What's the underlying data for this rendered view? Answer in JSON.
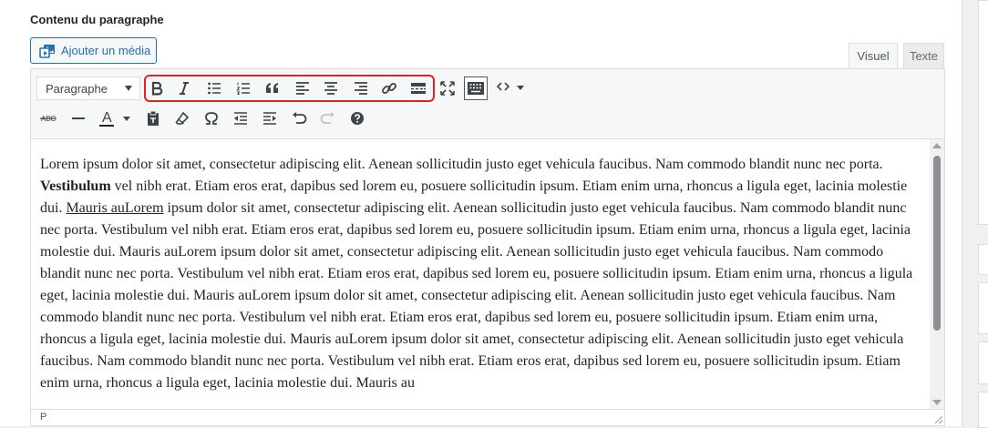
{
  "section": {
    "title": "Contenu du paragraphe"
  },
  "media_button": {
    "label": "Ajouter un média",
    "icon": "media-icon"
  },
  "tabs": [
    {
      "label": "Visuel",
      "active": true
    },
    {
      "label": "Texte",
      "active": false
    }
  ],
  "toolbar": {
    "format_select": {
      "value": "Paragraphe"
    },
    "row1_icons": [
      "bold-icon",
      "italic-icon",
      "bullet-list-icon",
      "numbered-list-icon",
      "blockquote-icon",
      "align-left-icon",
      "align-center-icon",
      "align-right-icon",
      "link-icon",
      "read-more-icon",
      "fullscreen-icon",
      "toolbar-toggle-icon",
      "code-icon"
    ],
    "row2_icons": [
      "strikethrough-icon",
      "horizontal-line-icon",
      "text-color-icon",
      "paste-text-icon",
      "clear-formatting-icon",
      "special-character-icon",
      "outdent-icon",
      "indent-icon",
      "undo-icon",
      "redo-icon",
      "help-icon"
    ],
    "highlight_color": "#e02424"
  },
  "content": {
    "segments": [
      {
        "text": "Lorem ipsum dolor sit amet, consectetur adipiscing elit. Aenean sollicitudin justo eget vehicula faucibus. Nam commodo blandit nunc nec porta. ",
        "style": "normal"
      },
      {
        "text": "Vestibulum",
        "style": "bold"
      },
      {
        "text": " vel nibh erat. Etiam eros erat, dapibus sed lorem eu, posuere sollicitudin ipsum. Etiam enim urna, rhoncus a ligula eget, lacinia molestie dui. ",
        "style": "normal"
      },
      {
        "text": "Mauris auLorem",
        "style": "underline"
      },
      {
        "text": " ipsum dolor sit amet, consectetur adipiscing elit. Aenean sollicitudin justo eget vehicula faucibus. Nam commodo blandit nunc nec porta. Vestibulum vel nibh erat. Etiam eros erat, dapibus sed lorem eu, posuere sollicitudin ipsum. Etiam enim urna, rhoncus a ligula eget, lacinia molestie dui. Mauris auLorem ipsum dolor sit amet, consectetur adipiscing elit. Aenean sollicitudin justo eget vehicula faucibus. Nam commodo blandit nunc nec porta. Vestibulum vel nibh erat. Etiam eros erat, dapibus sed lorem eu, posuere sollicitudin ipsum. Etiam enim urna, rhoncus a ligula eget, lacinia molestie dui. Mauris auLorem ipsum dolor sit amet, consectetur adipiscing elit. Aenean sollicitudin justo eget vehicula faucibus. Nam commodo blandit nunc nec porta. Vestibulum vel nibh erat. Etiam eros erat, dapibus sed lorem eu, posuere sollicitudin ipsum. Etiam enim urna, rhoncus a ligula eget, lacinia molestie dui. Mauris auLorem ipsum dolor sit amet, consectetur adipiscing elit. Aenean sollicitudin justo eget vehicula faucibus. Nam commodo blandit nunc nec porta. Vestibulum vel nibh erat. Etiam eros erat, dapibus sed lorem eu, posuere sollicitudin ipsum. Etiam enim urna, rhoncus a ligula eget, lacinia molestie dui. Mauris au",
        "style": "normal"
      }
    ]
  },
  "statusbar": {
    "path": "P"
  }
}
